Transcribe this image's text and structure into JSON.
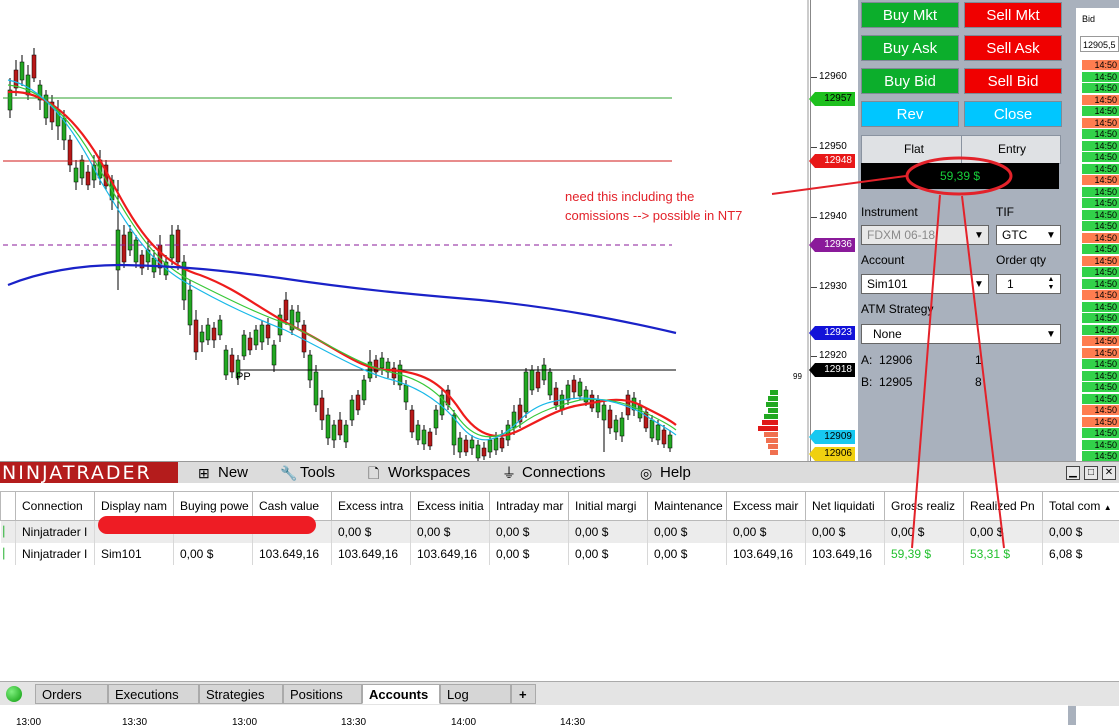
{
  "price_axis": {
    "labels": [
      "12960",
      "12950",
      "12940",
      "12930",
      "12920"
    ],
    "tags": [
      {
        "text": "12957",
        "bg": "#1ec01e",
        "fg": "#000000"
      },
      {
        "text": "12948",
        "bg": "#e81818",
        "fg": "#ffffff"
      },
      {
        "text": "12936",
        "bg": "#8a1a9a",
        "fg": "#ffffff"
      },
      {
        "text": "12923",
        "bg": "#1212d8",
        "fg": "#ffffff"
      },
      {
        "text": "12918",
        "bg": "#000000",
        "fg": "#ffffff"
      },
      {
        "text": "12909",
        "bg": "#18c8f0",
        "fg": "#000000"
      },
      {
        "text": "12906",
        "bg": "#f0d010",
        "fg": "#000000"
      }
    ],
    "small_label": "99"
  },
  "chart": {
    "pp_label": "PP",
    "colors": {
      "up": "#22a822",
      "down": "#b81818",
      "ema_fast": "#18b8e8",
      "ema_mid": "#38c838",
      "ema_slow": "#ee1c1c",
      "sma": "#1a22c8"
    }
  },
  "annotation": {
    "line1": "need this including the",
    "line2": "comissions --> possible in NT7"
  },
  "order_panel": {
    "buttons": {
      "buy_mkt": "Buy Mkt",
      "sell_mkt": "Sell Mkt",
      "buy_ask": "Buy Ask",
      "sell_ask": "Sell Ask",
      "buy_bid": "Buy Bid",
      "sell_bid": "Sell Bid",
      "rev": "Rev",
      "close": "Close"
    },
    "position": {
      "flat": "Flat",
      "entry": "Entry",
      "value": "59,39 $"
    },
    "instrument_label": "Instrument",
    "instrument_value": "FDXM 06-18",
    "tif_label": "TIF",
    "tif_value": "GTC",
    "account_label": "Account",
    "account_value": "Sim101",
    "qty_label": "Order qty",
    "qty_value": "1",
    "atm_label": "ATM Strategy",
    "atm_value": "None",
    "ask_label": "A:",
    "ask_price": "12906",
    "ask_qty": "1",
    "bid_label": "B:",
    "bid_price": "12905",
    "bid_qty": "8"
  },
  "dom": {
    "header": "Bid",
    "field": "12905,5",
    "time": "14:50"
  },
  "menu": {
    "logo": "NINJATRADER",
    "new": "New",
    "tools": "Tools",
    "workspaces": "Workspaces",
    "connections": "Connections",
    "help": "Help"
  },
  "accounts": {
    "columns": [
      "Connection",
      "Display nam",
      "Buying powe",
      "Cash value",
      "Excess intra",
      "Excess initia",
      "Intraday mar",
      "Initial margi",
      "Maintenance",
      "Excess mair",
      "Net liquidati",
      "Gross realiz",
      "Realized Pn",
      "Total com"
    ],
    "rows": [
      {
        "cells": [
          "Ninjatrader I",
          "",
          "",
          "",
          "0,00 $",
          "0,00 $",
          "0,00 $",
          "0,00 $",
          "0,00 $",
          "0,00 $",
          "0,00 $",
          "0,00 $",
          "0,00 $",
          "0,00 $"
        ]
      },
      {
        "cells": [
          "Ninjatrader I",
          "Sim101",
          "0,00 $",
          "103.649,16",
          "103.649,16",
          "103.649,16",
          "0,00 $",
          "0,00 $",
          "0,00 $",
          "103.649,16",
          "103.649,16",
          "59,39 $",
          "53,31 $",
          "6,08 $"
        ]
      }
    ]
  },
  "tabs": [
    "Orders",
    "Executions",
    "Strategies",
    "Positions",
    "Accounts",
    "Log"
  ],
  "add_tab": "+",
  "time_axis": [
    "13:00",
    "13:30",
    "13:00",
    "13:30",
    "14:00",
    "14:30"
  ]
}
